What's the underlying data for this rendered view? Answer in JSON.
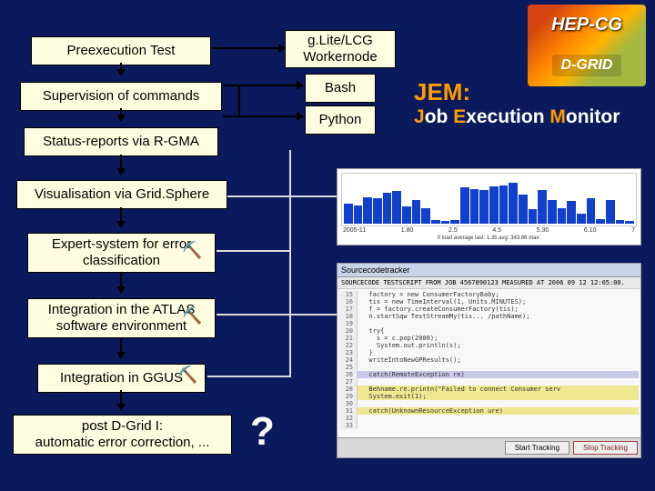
{
  "logo": {
    "top": "HEP-CG",
    "bottom": "D-GRID"
  },
  "title": {
    "short": "JEM:",
    "full_j": "J",
    "full_job": "ob ",
    "full_e": "E",
    "full_exec": "xecution ",
    "full_m": "M",
    "full_mon": "onitor"
  },
  "boxes": {
    "preexec": "Preexecution Test",
    "supervision": "Supervision of  commands",
    "status": "Status-reports via R-GMA",
    "visual": "Visualisation via Grid.Sphere",
    "expert": "Expert-system for error classification",
    "atlas": "Integration in the ATLAS software environment",
    "ggus": "Integration in GGUS",
    "post": "post D-Grid I:\nautomatic error correction, ...",
    "workernode": "g.Lite/LCG Workernode",
    "bash": "Bash",
    "python": "Python"
  },
  "qmark": "?",
  "chart1": {
    "axis": [
      "2005-11",
      "1.80",
      "2.5",
      "4.5",
      "5.30",
      "6.10",
      "7"
    ],
    "legend": "0 load average   last:  1.35   avg:  343.86   max:"
  },
  "chart_data": {
    "type": "bar",
    "title": "load average",
    "categories": [
      "2005-11",
      "1.80",
      "2.5",
      "4.5",
      "5.30",
      "6.10",
      "7"
    ],
    "values": [
      42,
      38,
      55,
      52,
      65,
      68,
      35,
      50,
      32,
      7,
      5,
      8,
      75,
      72,
      70,
      78,
      80,
      85,
      60,
      30,
      70,
      50,
      32,
      48,
      20,
      52,
      10,
      50,
      8,
      5
    ],
    "ylim": [
      0,
      100
    ],
    "xlabel": "",
    "ylabel": ""
  },
  "chart2": {
    "titlebar": "Sourcecodetracker",
    "header": "SOURCECODE TESTSCRIPT FROM JOB 4567890123 MEASURED AT 2006 09 12 12:05:00.",
    "lines": [
      {
        "n": "15",
        "t": "  factory = new ConsumerFactoryBaby;"
      },
      {
        "n": "16",
        "t": "  tis = new TimeInterval(1, Units.MINUTES);"
      },
      {
        "n": "17",
        "t": "  f = factory.createConsumerFactory(tis);"
      },
      {
        "n": "18",
        "t": "  n.startSqw TestStreamMy(tis... /pathName);"
      },
      {
        "n": "19",
        "t": ""
      },
      {
        "n": "20",
        "t": "  try{"
      },
      {
        "n": "21",
        "t": "    s = c.pop(2000);"
      },
      {
        "n": "22",
        "t": "    System.out.println(s);"
      },
      {
        "n": "23",
        "t": "  }"
      },
      {
        "n": "24",
        "t": "  writeIntoNewGPResults();"
      },
      {
        "n": "25",
        "t": ""
      },
      {
        "n": "26",
        "t": "  catch(RemoteException re)"
      },
      {
        "n": "27",
        "t": ""
      },
      {
        "n": "28",
        "t": "  Behname.re.printn(\"Failed to connect Consumer serv"
      },
      {
        "n": "29",
        "t": "  System.exit(1);"
      },
      {
        "n": "30",
        "t": ""
      },
      {
        "n": "31",
        "t": "  catch(UnknownResourceException ure)"
      },
      {
        "n": "32",
        "t": ""
      },
      {
        "n": "33",
        "t": ""
      }
    ],
    "buttons": {
      "start": "Start Tracking",
      "stop": "Stop Tracking"
    }
  }
}
